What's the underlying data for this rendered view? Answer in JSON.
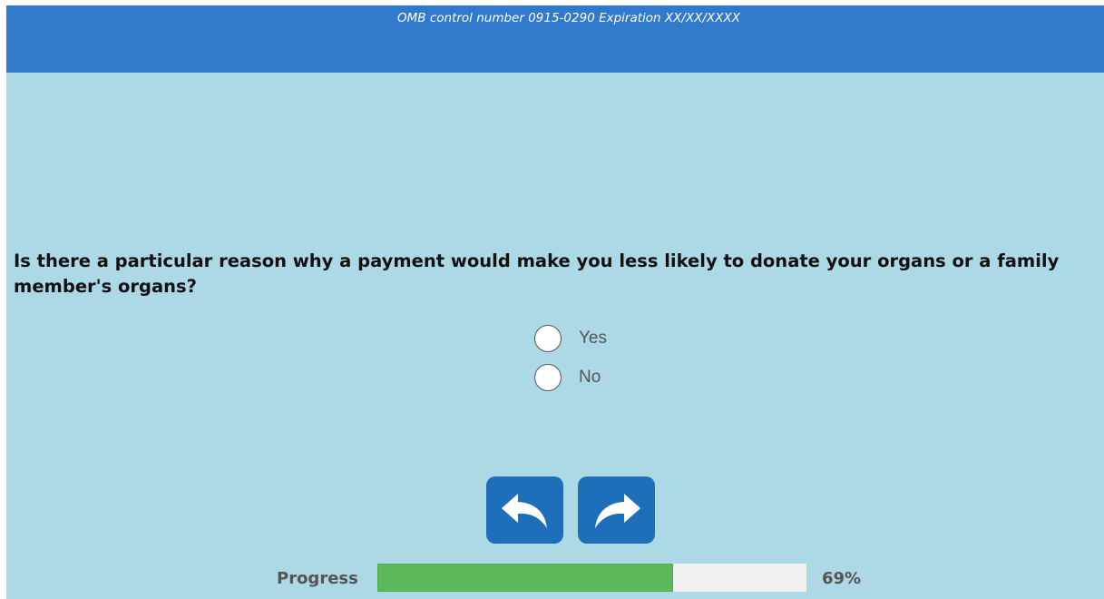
{
  "header": {
    "omb_text": "OMB control number 0915-0290 Expiration XX/XX/XXXX"
  },
  "question": {
    "text": "Is there a particular reason why a payment would make you less likely to donate your organs or a family member's organs?",
    "options": [
      {
        "label": "Yes",
        "selected": false
      },
      {
        "label": "No",
        "selected": false
      }
    ]
  },
  "navigation": {
    "back_icon": "back-arrow-icon",
    "next_icon": "forward-arrow-icon"
  },
  "progress": {
    "label": "Progress",
    "percent_text": "69%",
    "fraction": 0.69
  },
  "colors": {
    "header": "#3079cb",
    "background": "#add8e6",
    "button": "#1e6fba",
    "progress_fill": "#5cb85c",
    "progress_track": "#f1f1f1"
  }
}
